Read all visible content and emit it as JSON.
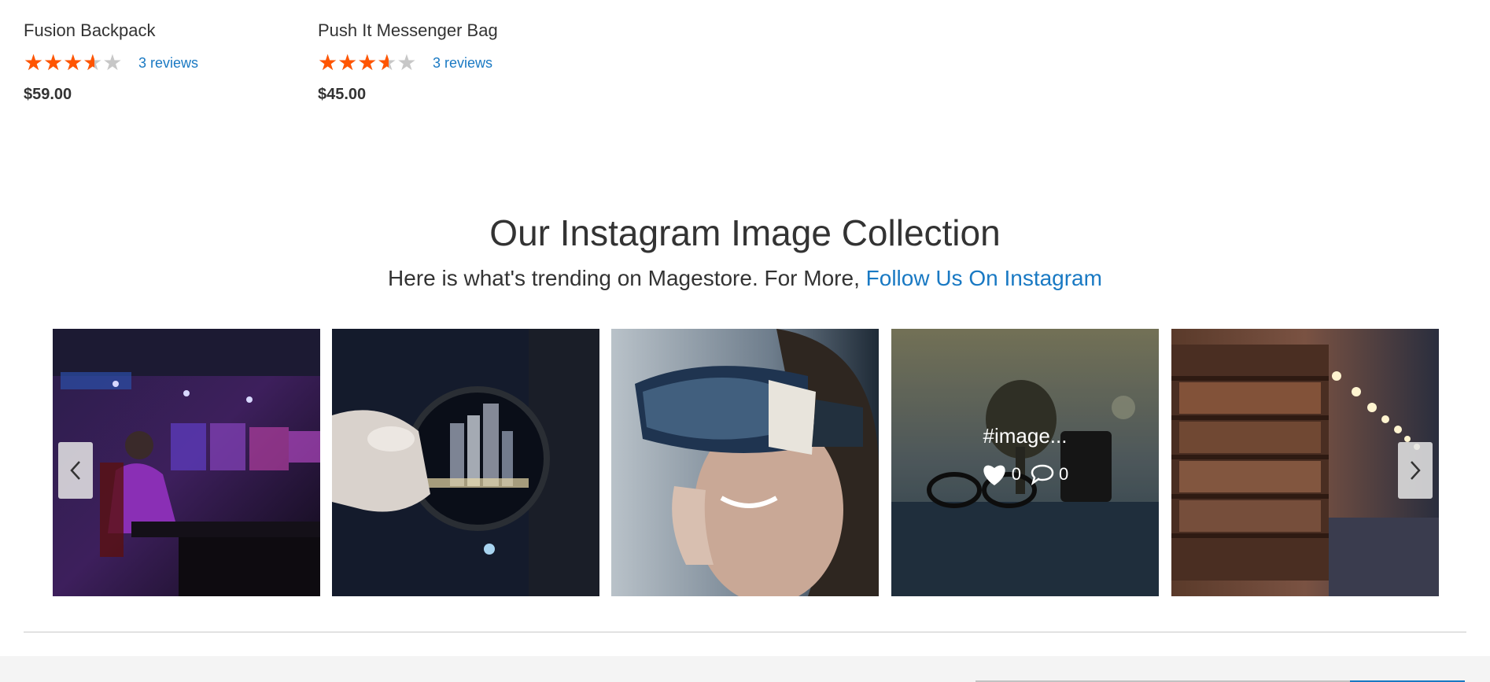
{
  "products": [
    {
      "name": "Fusion Backpack",
      "rating_percent": 67,
      "reviews_label": "3 reviews",
      "price": "$59.00"
    },
    {
      "name": "Push It Messenger Bag",
      "rating_percent": 67,
      "reviews_label": "3 reviews",
      "price": "$45.00"
    }
  ],
  "instagram": {
    "title": "Our Instagram Image Collection",
    "subtitle_text": "Here is what's trending on Magestore. For More, ",
    "follow_link": "Follow Us On Instagram",
    "hover_caption": "#image...",
    "likes": "0",
    "comments": "0"
  },
  "icons": {
    "star": "star-icon",
    "prev": "chevron-left-icon",
    "next": "chevron-right-icon",
    "like": "heart-icon",
    "comment": "comment-icon"
  },
  "colors": {
    "star_filled": "#ff5501",
    "star_empty": "#c7c7c7",
    "link": "#1979c3",
    "text": "#333333",
    "footer_bg": "#f4f4f4"
  }
}
